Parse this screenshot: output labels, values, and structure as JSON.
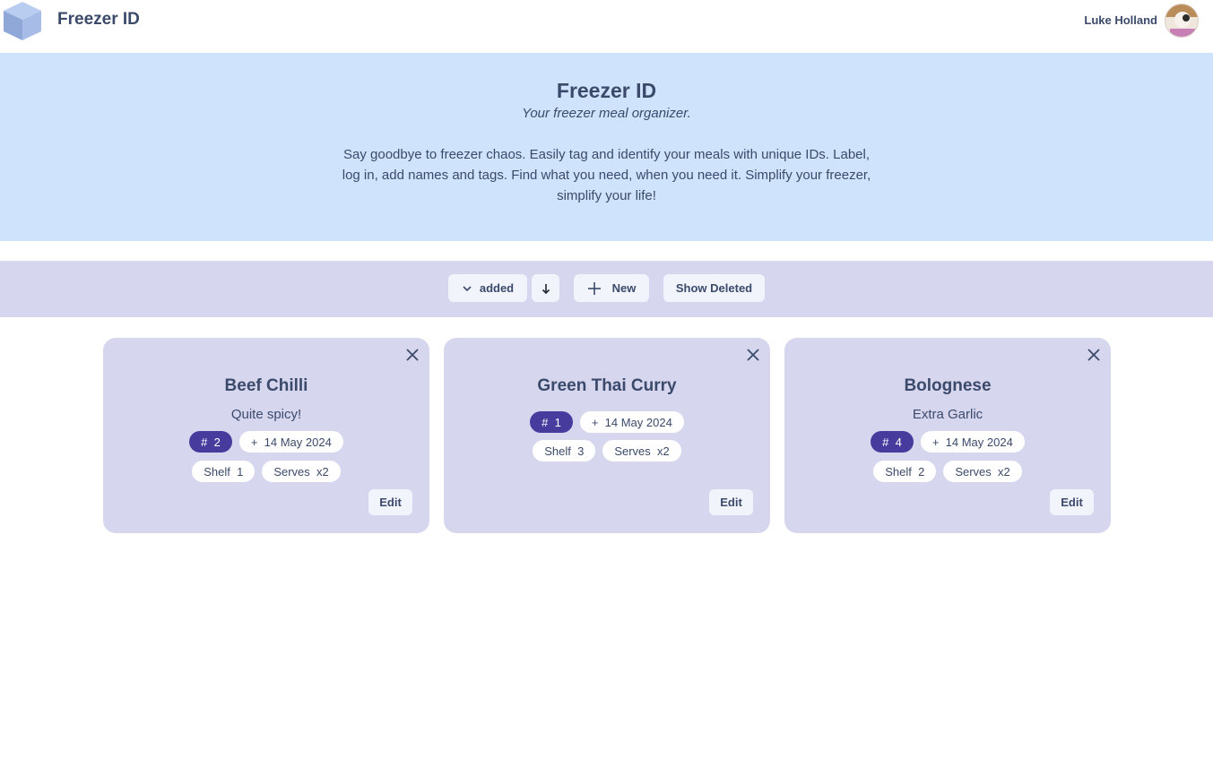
{
  "header": {
    "app_name": "Freezer ID",
    "user_name": "Luke Holland",
    "logo_icon": "cube-icon",
    "avatar_icon": "user-avatar"
  },
  "hero": {
    "title": "Freezer ID",
    "tagline": "Your freezer meal organizer.",
    "description": "Say goodbye to freezer chaos. Easily tag and identify your meals with unique IDs. Label, log in, add names and tags. Find what you need, when you need it. Simplify your freezer, simplify your life!"
  },
  "toolbar": {
    "sort_label": "added",
    "sort_icon": "chevron-down-icon",
    "direction_icon": "arrow-down-icon",
    "new_label": "New",
    "new_icon": "plus-icon",
    "show_deleted_label": "Show Deleted"
  },
  "cards": [
    {
      "title": "Beef Chilli",
      "note": "Quite spicy!",
      "id_chip": "#  2",
      "date_chip": "+  14 May 2024",
      "shelf_chip": "Shelf  1",
      "serves_chip": "Serves  x2",
      "edit_label": "Edit"
    },
    {
      "title": "Green Thai Curry",
      "note": "",
      "id_chip": "#  1",
      "date_chip": "+  14 May 2024",
      "shelf_chip": "Shelf  3",
      "serves_chip": "Serves  x2",
      "edit_label": "Edit"
    },
    {
      "title": "Bolognese",
      "note": "Extra Garlic",
      "id_chip": "#  4",
      "date_chip": "+  14 May 2024",
      "shelf_chip": "Shelf  2",
      "serves_chip": "Serves  x2",
      "edit_label": "Edit"
    }
  ],
  "colors": {
    "hero_bg": "#cfe3fd",
    "toolbar_bg": "#d6d7ee",
    "card_bg": "#d6d7ee",
    "id_chip_bg": "#473c9e",
    "text": "#3b4a6b"
  }
}
